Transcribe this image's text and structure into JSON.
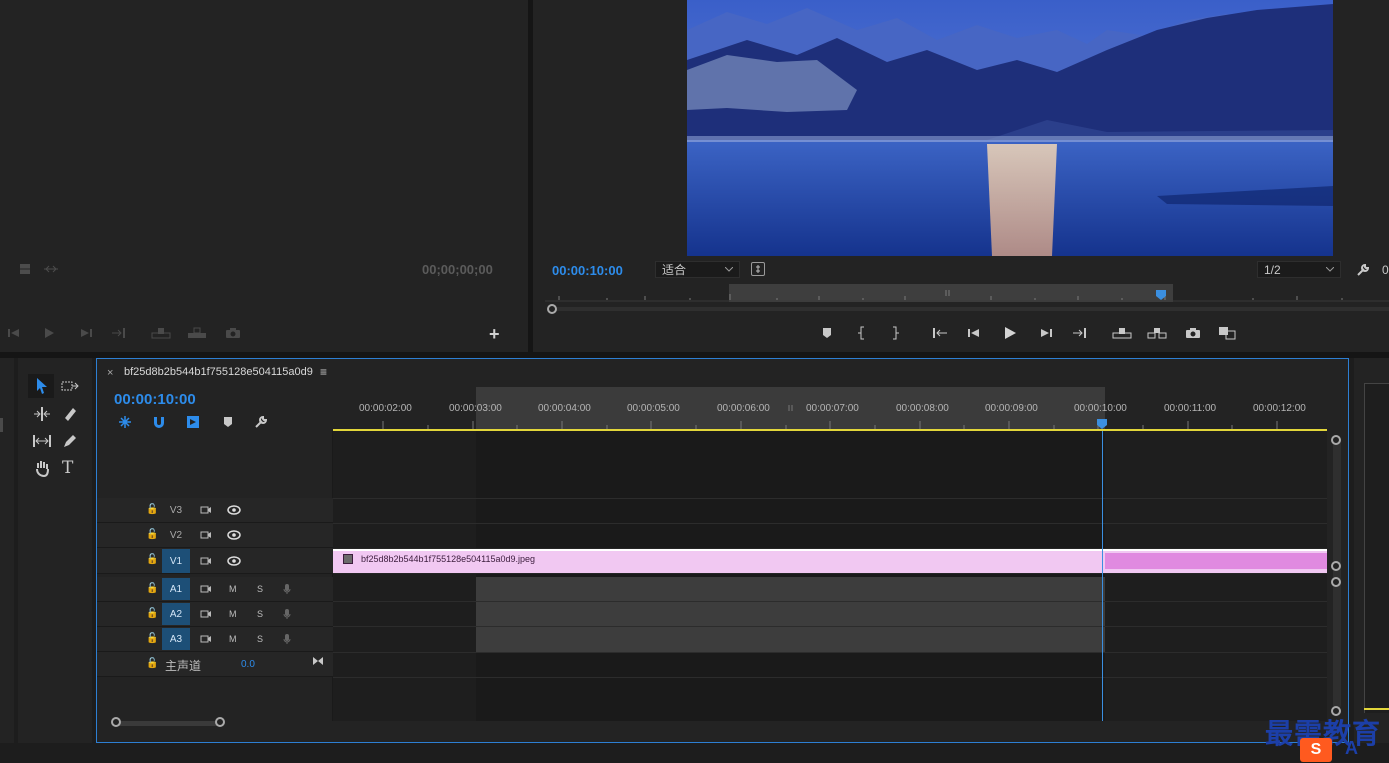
{
  "source_monitor": {
    "timecode": "00;00;00;00"
  },
  "program_monitor": {
    "timecode": "00:00:10:00",
    "zoom": "适合",
    "resolution": "1/2",
    "right_edge_text": "0"
  },
  "timeline": {
    "sequence_name": "bf25d8b2b544b1f755128e504115a0d9",
    "close_glyph": "×",
    "menu_glyph": "≡",
    "timecode": "00:00:10:00",
    "ruler_labels": [
      "00:00:02:00",
      "00:00:03:00",
      "00:00:04:00",
      "00:00:05:00",
      "00:00:06:00",
      "00:00:07:00",
      "00:00:08:00",
      "00:00:09:00",
      "00:00:10:00",
      "00:00:11:00",
      "00:00:12:00"
    ],
    "video_tracks": [
      {
        "name": "V3",
        "active": false
      },
      {
        "name": "V2",
        "active": false
      },
      {
        "name": "V1",
        "active": true
      }
    ],
    "audio_tracks": [
      {
        "name": "A1",
        "m": "M",
        "s": "S"
      },
      {
        "name": "A2",
        "m": "M",
        "s": "S"
      },
      {
        "name": "A3",
        "m": "M",
        "s": "S"
      }
    ],
    "master": {
      "label": "主声道",
      "value": "0.0"
    },
    "clip": {
      "label": "bf25d8b2b544b1f755128e504115a0d9.jpeg"
    }
  },
  "watermark": {
    "text": "最需教育"
  },
  "colors": {
    "accent_blue": "#2d8ceb",
    "playhead": "#3b8fe0",
    "work_area_yellow": "#e2d63a",
    "clip_pink": "#f1c8f2",
    "clip_pink_dark": "#e08ae0",
    "panel": "#232323",
    "panel_border_active": "#2d7fd3"
  },
  "icons": [
    "grid-icon",
    "insert-icon",
    "play-icon",
    "step-back-icon",
    "step-forward-icon",
    "mark-in-icon",
    "mark-out-icon",
    "go-in-icon",
    "go-out-icon",
    "lift-icon",
    "extract-icon",
    "camera-icon",
    "compare-icon",
    "plus-icon",
    "wrench-icon",
    "selection-tool-icon",
    "track-select-icon",
    "ripple-edit-icon",
    "razor-icon",
    "slip-icon",
    "pen-icon",
    "hand-icon",
    "type-icon",
    "snap-icon",
    "magnet-icon",
    "linked-icon",
    "marker-icon",
    "lock-icon",
    "toggle-output-icon",
    "eye-icon",
    "mic-icon"
  ]
}
